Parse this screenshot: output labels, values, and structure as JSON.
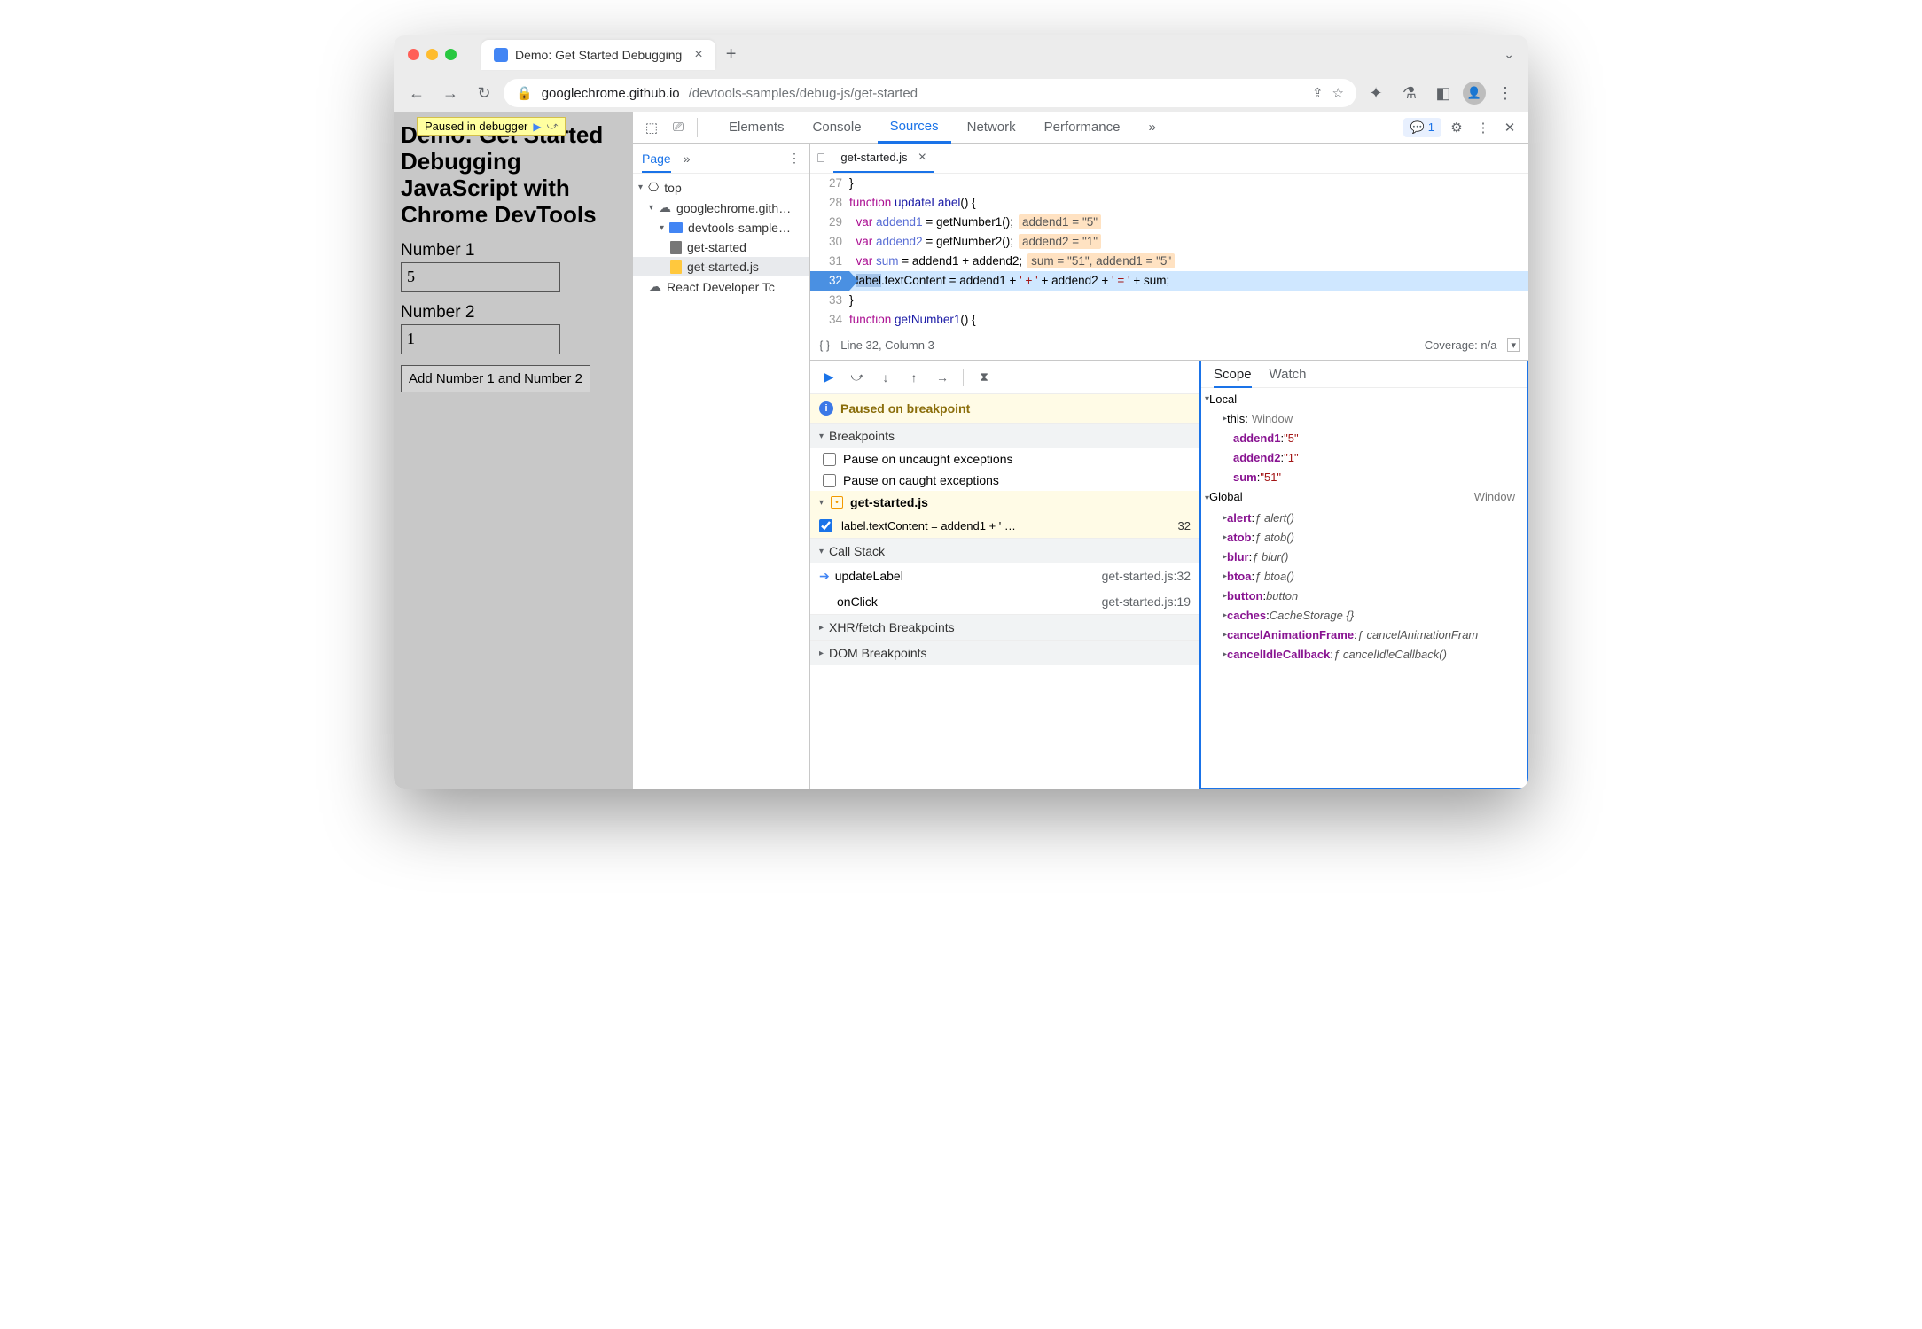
{
  "browser": {
    "tab_title": "Demo: Get Started Debugging",
    "url_host": "googlechrome.github.io",
    "url_path": "/devtools-samples/debug-js/get-started",
    "issues_count": "1"
  },
  "page": {
    "paused_label": "Paused in debugger",
    "h1": "Demo: Get Started Debugging JavaScript with Chrome DevTools",
    "label1": "Number 1",
    "value1": "5",
    "label2": "Number 2",
    "value2": "1",
    "button": "Add Number 1 and Number 2"
  },
  "devtools": {
    "tabs": {
      "elements": "Elements",
      "console": "Console",
      "sources": "Sources",
      "network": "Network",
      "performance": "Performance",
      "more": "»"
    },
    "pages": {
      "page": "Page",
      "more": "»"
    },
    "tree": {
      "top": "top",
      "site": "googlechrome.gith…",
      "folder": "devtools-sample…",
      "file1": "get-started",
      "file2": "get-started.js",
      "react": "React Developer Tc"
    },
    "editor": {
      "open_file": "get-started.js",
      "lines": {
        "27": "}",
        "28_pre": "function ",
        "28_fn": "updateLabel",
        "28_post": "() {",
        "29_pre": "  var ",
        "29_v": "addend1",
        "29_mid": " = getNumber1();",
        "29_ann": "addend1 = \"5\"",
        "30_pre": "  var ",
        "30_v": "addend2",
        "30_mid": " = getNumber2();",
        "30_ann": "addend2 = \"1\"",
        "31_pre": "  var ",
        "31_v": "sum",
        "31_mid": " = addend1 + addend2;",
        "31_ann": "sum = \"51\", addend1 = \"5\"",
        "32_sel": "label",
        "32_rest": ".textContent = addend1 + ",
        "32_s1": "' + '",
        "32_m2": " + addend2 + ",
        "32_s2": "' = '",
        "32_m3": " + sum;",
        "33": "}",
        "34_pre": "function ",
        "34_fn": "getNumber1",
        "34_post": "() {"
      },
      "footer_pos": "Line 32, Column 3",
      "coverage": "Coverage: n/a"
    },
    "debug": {
      "paused_msg": "Paused on breakpoint",
      "sec_bp": "Breakpoints",
      "chk1": "Pause on uncaught exceptions",
      "chk2": "Pause on caught exceptions",
      "bp_file": "get-started.js",
      "bp_code": "label.textContent = addend1 + ' …",
      "bp_ln": "32",
      "sec_cs": "Call Stack",
      "cs1": "updateLabel",
      "cs1r": "get-started.js:32",
      "cs2": "onClick",
      "cs2r": "get-started.js:19",
      "sec_xhr": "XHR/fetch Breakpoints",
      "sec_dom": "DOM Breakpoints"
    },
    "scope": {
      "tab_scope": "Scope",
      "tab_watch": "Watch",
      "local": "Local",
      "global": "Global",
      "global_val": "Window",
      "this_k": "this",
      "this_v": "Window",
      "a1k": "addend1",
      "a1v": "\"5\"",
      "a2k": "addend2",
      "a2v": "\"1\"",
      "sumk": "sum",
      "sumv": "\"51\"",
      "g": [
        {
          "k": "alert",
          "v": "ƒ alert()"
        },
        {
          "k": "atob",
          "v": "ƒ atob()"
        },
        {
          "k": "blur",
          "v": "ƒ blur()"
        },
        {
          "k": "btoa",
          "v": "ƒ btoa()"
        },
        {
          "k": "button",
          "v": "button"
        },
        {
          "k": "caches",
          "v": "CacheStorage {}"
        },
        {
          "k": "cancelAnimationFrame",
          "v": "ƒ cancelAnimationFram"
        },
        {
          "k": "cancelIdleCallback",
          "v": "ƒ cancelIdleCallback()"
        }
      ]
    }
  }
}
